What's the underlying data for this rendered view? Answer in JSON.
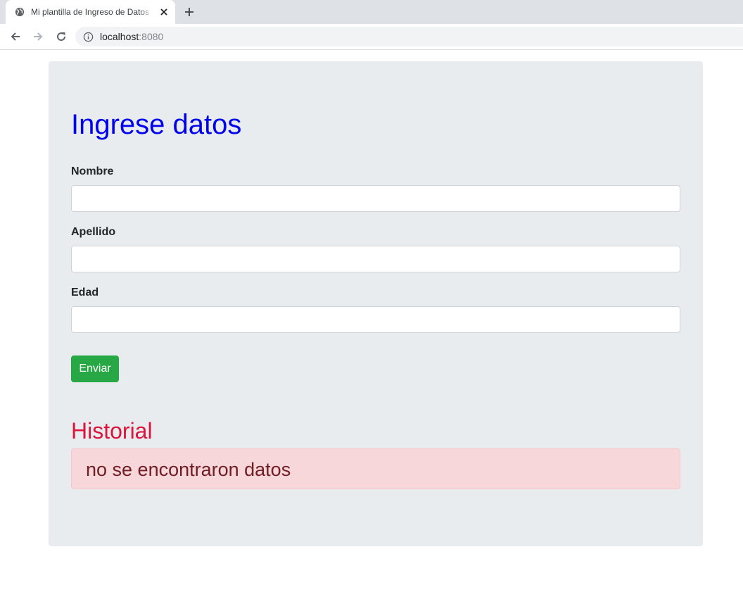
{
  "browser": {
    "tab_title": "Mi plantilla de Ingreso de Datos",
    "url_host": "localhost",
    "url_port": ":8080"
  },
  "page": {
    "title": "Ingrese datos",
    "fields": [
      {
        "label": "Nombre",
        "value": ""
      },
      {
        "label": "Apellido",
        "value": ""
      },
      {
        "label": "Edad",
        "value": ""
      }
    ],
    "submit_label": "Enviar",
    "history_title": "Historial",
    "empty_message": "no se encontraron datos"
  },
  "colors": {
    "title": "#0000ee",
    "history_title": "#dc143c",
    "submit_button": "#28a745",
    "alert_background": "#f8d7da",
    "alert_text": "#721c24",
    "panel_background": "#e9ecef"
  },
  "icons": {
    "tab_favicon": "globe-icon",
    "tab_close": "close-icon",
    "new_tab": "plus-icon",
    "back": "back-arrow-icon",
    "forward": "forward-arrow-icon",
    "reload": "reload-icon",
    "site_info": "info-icon"
  }
}
